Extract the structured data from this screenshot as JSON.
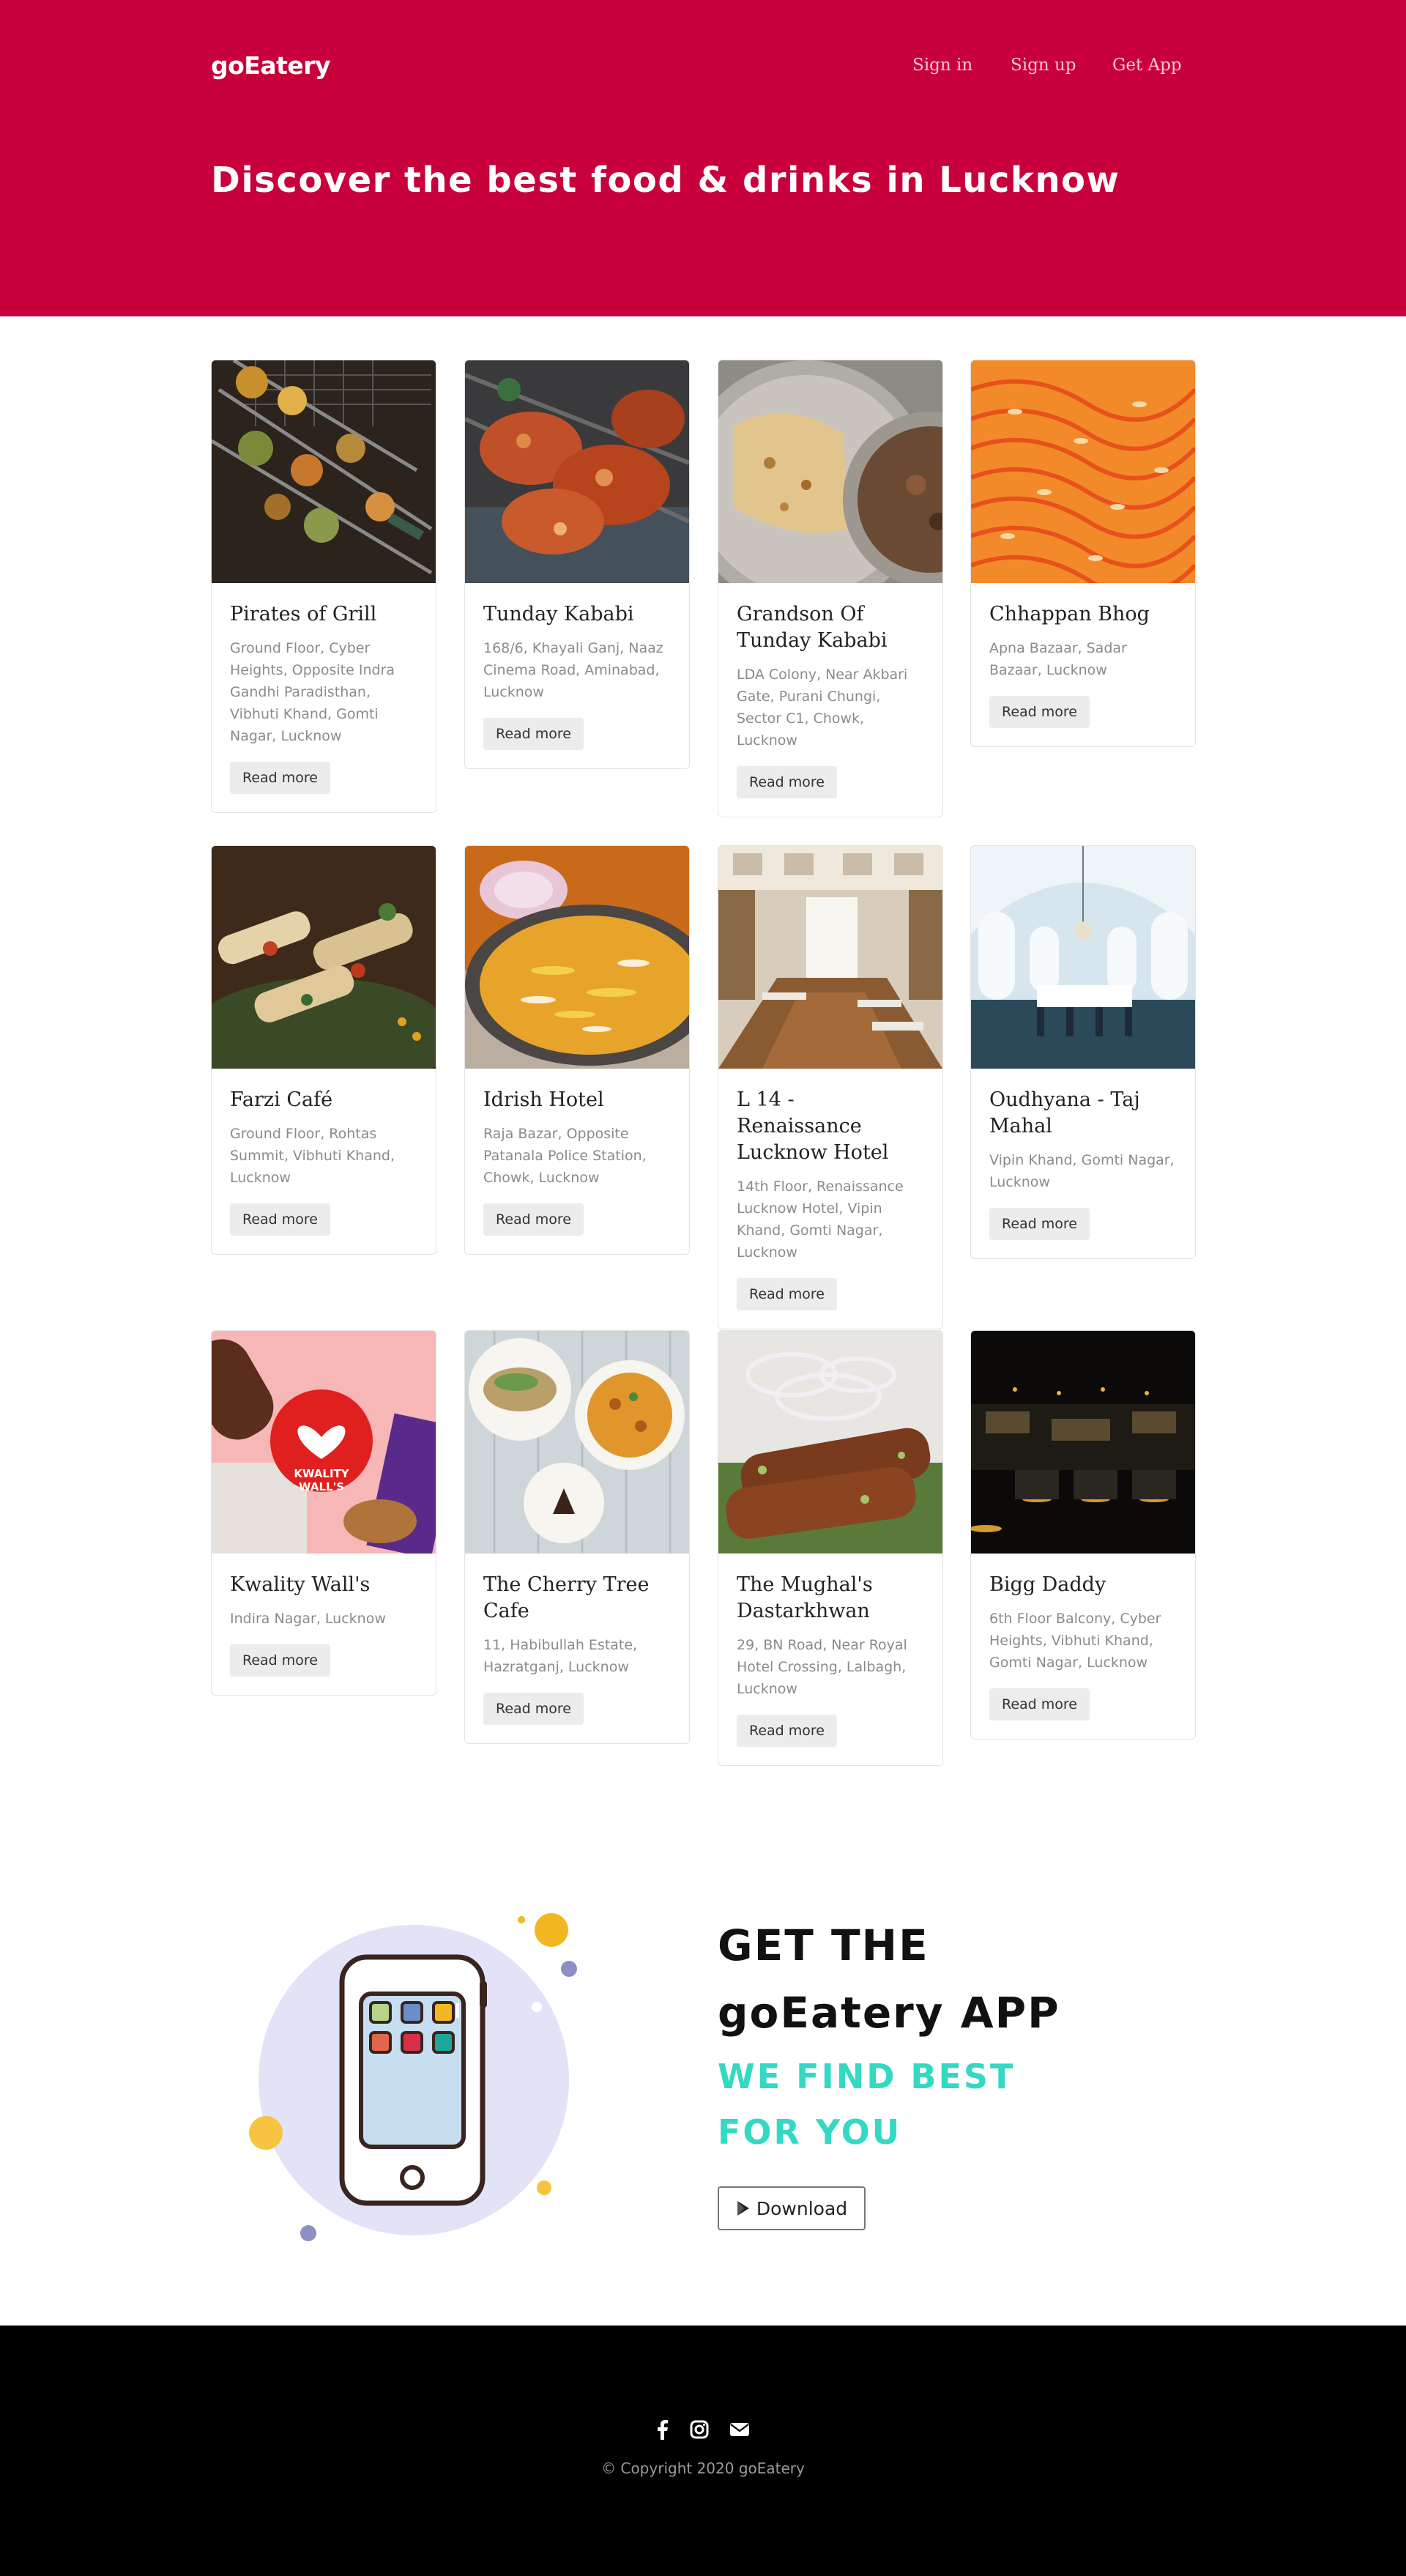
{
  "header": {
    "brand": "goEatery",
    "nav": {
      "signin": "Sign in",
      "signup": "Sign up",
      "getapp": "Get App"
    },
    "headline": "Discover the best food & drinks in Lucknow",
    "background_color": "#c8003c"
  },
  "restaurants": [
    {
      "name": "Pirates of Grill",
      "address": "Ground Floor, Cyber Heights, Opposite Indra Gandhi Paradisthan, Vibhuti Khand, Gomti Nagar, Lucknow",
      "button": "Read more",
      "image": "grilled-skewers"
    },
    {
      "name": "Tunday Kababi",
      "address": "168/6, Khayali Ganj, Naaz Cinema Road, Aminabad, Lucknow",
      "button": "Read more",
      "image": "tandoori-chicken"
    },
    {
      "name": "Grandson Of Tunday Kababi",
      "address": "LDA Colony, Near Akbari Gate, Purani Chungi, Sector C1, Chowk, Lucknow",
      "button": "Read more",
      "image": "paratha-plate"
    },
    {
      "name": "Chhappan Bhog",
      "address": "Apna Bazaar, Sadar Bazaar, Lucknow",
      "button": "Read more",
      "image": "jalebi-sweets"
    },
    {
      "name": "Farzi Café",
      "address": "Ground Floor, Rohtas Summit, Vibhuti Khand, Lucknow",
      "button": "Read more",
      "image": "rolls-platter"
    },
    {
      "name": "Idrish Hotel",
      "address": "Raja Bazar, Opposite Patanala Police Station, Chowk, Lucknow",
      "button": "Read more",
      "image": "biryani"
    },
    {
      "name": "L 14 - Renaissance Lucknow Hotel",
      "address": "14th Floor, Renaissance Lucknow Hotel, Vipin Khand, Gomti Nagar, Lucknow",
      "button": "Read more",
      "image": "dining-hall"
    },
    {
      "name": "Oudhyana - Taj Mahal",
      "address": "Vipin Khand, Gomti Nagar, Lucknow",
      "button": "Read more",
      "image": "banquet-room"
    },
    {
      "name": "Kwality Wall's",
      "address": "Indira Nagar, Lucknow",
      "button": "Read more",
      "image": "ice-cream",
      "logo_text": [
        "KWALITY",
        "WALL'S"
      ]
    },
    {
      "name": "The Cherry Tree Cafe",
      "address": "11, Habibullah Estate, Hazratganj, Lucknow",
      "button": "Read more",
      "image": "cafe-plates"
    },
    {
      "name": "The Mughal's Dastarkhwan",
      "address": "29, BN Road, Near Royal Hotel Crossing, Lalbagh, Lucknow",
      "button": "Read more",
      "image": "seekh-kebab"
    },
    {
      "name": "Bigg Daddy",
      "address": "6th Floor Balcony, Cyber Heights, Vibhuti Khand, Gomti Nagar, Lucknow",
      "button": "Read more",
      "image": "dark-lounge"
    }
  ],
  "app_section": {
    "line1": "GET THE",
    "line2": "goEatery APP",
    "tagline1": "WE FIND BEST",
    "tagline2": "FOR YOU",
    "download_label": "Download",
    "accent_color": "#33d9c2"
  },
  "footer": {
    "icons": [
      "facebook-icon",
      "instagram-icon",
      "envelope-icon"
    ],
    "copyright": "© Copyright 2020 goEatery"
  }
}
